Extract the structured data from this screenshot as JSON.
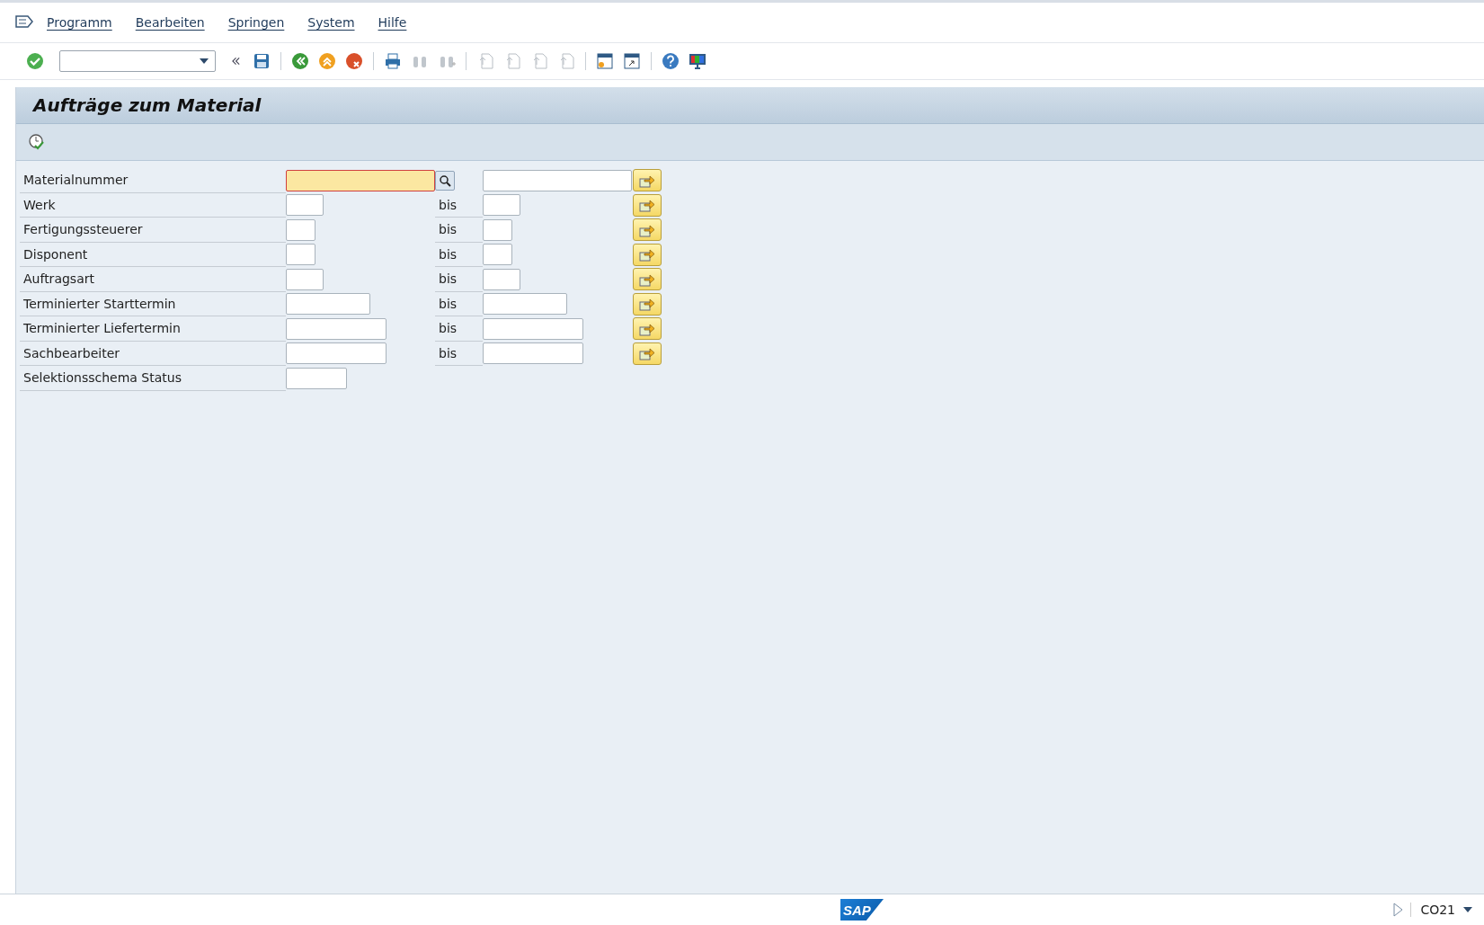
{
  "menu": [
    {
      "label": "Programm"
    },
    {
      "label": "Bearbeiten"
    },
    {
      "label": "Springen"
    },
    {
      "label": "System"
    },
    {
      "label": "Hilfe"
    }
  ],
  "title": "Aufträge zum Material",
  "rows": [
    {
      "kind": "range",
      "label": "Materialnummer",
      "focused": true,
      "search_help": true
    },
    {
      "kind": "range",
      "label": "Werk",
      "focused": false,
      "separator": "bis"
    },
    {
      "kind": "range",
      "label": "Fertigungssteuerer",
      "focused": false,
      "separator": "bis"
    },
    {
      "kind": "range",
      "label": "Disponent",
      "focused": false,
      "separator": "bis"
    },
    {
      "kind": "range",
      "label": "Auftragsart",
      "focused": false,
      "separator": "bis"
    },
    {
      "kind": "range",
      "label": "Terminierter Starttermin",
      "focused": false,
      "separator": "bis"
    },
    {
      "kind": "range",
      "label": "Terminierter Liefertermin",
      "focused": false,
      "separator": "bis"
    },
    {
      "kind": "range",
      "label": "Sachbearbeiter",
      "focused": false,
      "separator": "bis"
    },
    {
      "kind": "single",
      "label": "Selektionsschema Status",
      "focused": false
    }
  ],
  "status_bar": {
    "logo": "SAP",
    "transaction": "CO21"
  }
}
